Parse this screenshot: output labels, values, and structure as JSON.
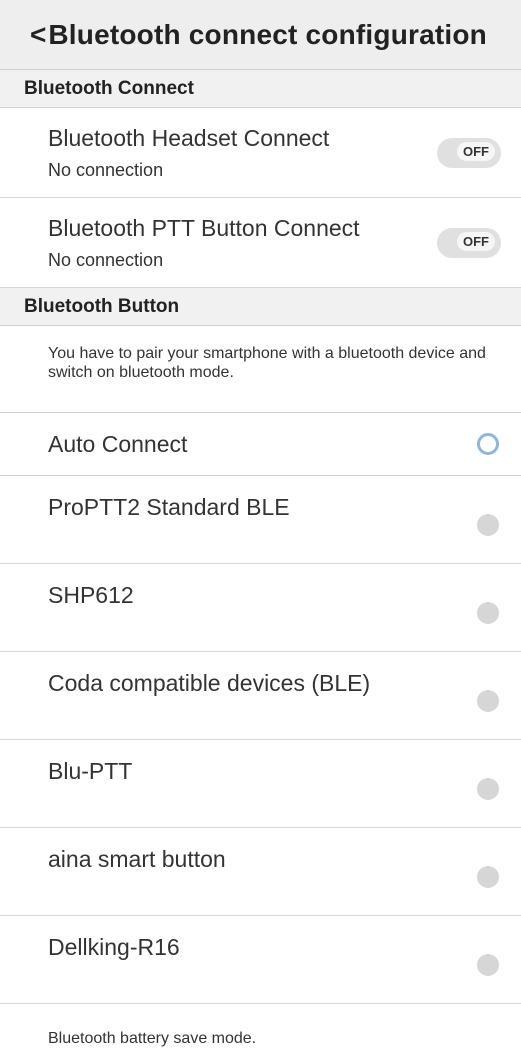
{
  "header": {
    "back_glyph": "<",
    "title": "Bluetooth connect configuration"
  },
  "section_connect": {
    "title": "Bluetooth Connect"
  },
  "headset": {
    "label": "Bluetooth Headset Connect",
    "status": "No connection",
    "toggle": "OFF"
  },
  "ptt": {
    "label": "Bluetooth PTT Button Connect",
    "status": "No connection",
    "toggle": "OFF"
  },
  "section_button": {
    "title": "Bluetooth Button"
  },
  "note": "You have to pair your smartphone with a bluetooth device and switch on bluetooth mode.",
  "auto_connect": {
    "label": "Auto Connect"
  },
  "devices": [
    {
      "label": "ProPTT2 Standard BLE"
    },
    {
      "label": "SHP612"
    },
    {
      "label": "Coda compatible devices (BLE)"
    },
    {
      "label": "Blu-PTT"
    },
    {
      "label": "aina smart button"
    },
    {
      "label": "Dellking-R16"
    }
  ],
  "footer": {
    "label": "Bluetooth battery save mode."
  }
}
